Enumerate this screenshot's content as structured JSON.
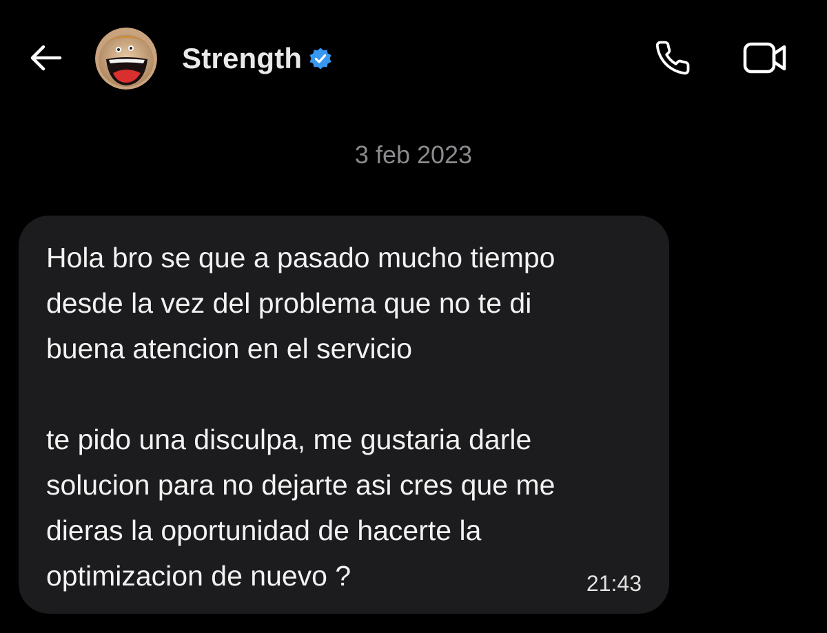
{
  "header": {
    "contact_name": "Strength",
    "icons": {
      "back": "arrow-left-icon",
      "avatar": "cartoon-avatar",
      "verified": "verified-badge-icon",
      "call": "phone-icon",
      "video": "video-camera-icon"
    }
  },
  "conversation": {
    "date": "3 feb 2023",
    "messages": [
      {
        "text": "Hola bro se que a pasado mucho tiempo\ndesde la vez del problema que no te di\nbuena atencion en el servicio\n\nte pido una disculpa, me gustaria darle\nsolucion para no dejarte asi cres que me\ndieras la oportunidad de hacerte la\noptimizacion de nuevo ?",
        "time": "21:43"
      }
    ]
  },
  "colors": {
    "background": "#000000",
    "bubble": "#1c1c1e",
    "verified": "#3897f0",
    "date_text": "#8a8a8e"
  }
}
